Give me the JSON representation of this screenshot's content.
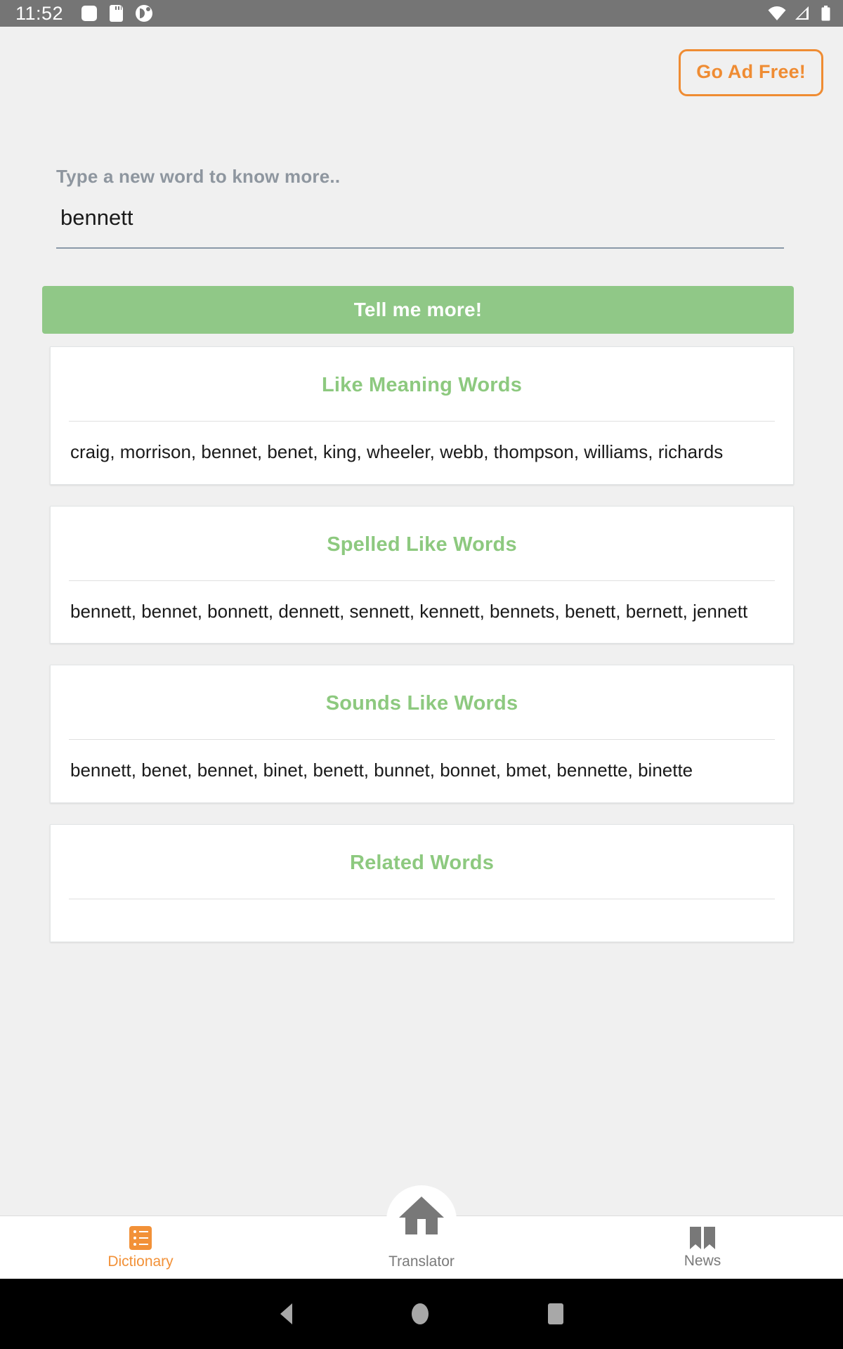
{
  "status_bar": {
    "time": "11:52",
    "left_icons": [
      "rounded-square-icon",
      "sd-card-icon",
      "app-circle-icon"
    ],
    "right_icons": [
      "wifi-icon",
      "signal-icon",
      "battery-icon"
    ]
  },
  "header": {
    "ad_free_label": "Go Ad Free!",
    "accent_color": "#ef8c33"
  },
  "search": {
    "label": "Type a new word to know more..",
    "value": "bennett",
    "placeholder": "Type a new word to know more..",
    "submit_label": "Tell me more!",
    "submit_color": "#90c887"
  },
  "cards": [
    {
      "title": "Like Meaning Words",
      "words": "craig, morrison, bennet, benet, king, wheeler, webb, thompson, williams, richards"
    },
    {
      "title": "Spelled Like Words",
      "words": "bennett, bennet, bonnett, dennett, sennett, kennett, bennets, benett, bernett, jennett"
    },
    {
      "title": "Sounds Like Words",
      "words": "bennett, benet, bennet, binet, benett, bunnet, bonnet, bmet, bennette, binette"
    },
    {
      "title": "Related Words",
      "words": ""
    }
  ],
  "card_title_color": "#8dc97f",
  "bottom_nav": {
    "items": [
      {
        "label": "Dictionary",
        "icon": "list-icon",
        "active": true
      },
      {
        "label": "Translator",
        "icon": "home-icon",
        "active": false
      },
      {
        "label": "News",
        "icon": "book-icon",
        "active": false
      }
    ]
  },
  "android_nav": {
    "back": "back-button",
    "home": "home-button",
    "recents": "recents-button"
  }
}
